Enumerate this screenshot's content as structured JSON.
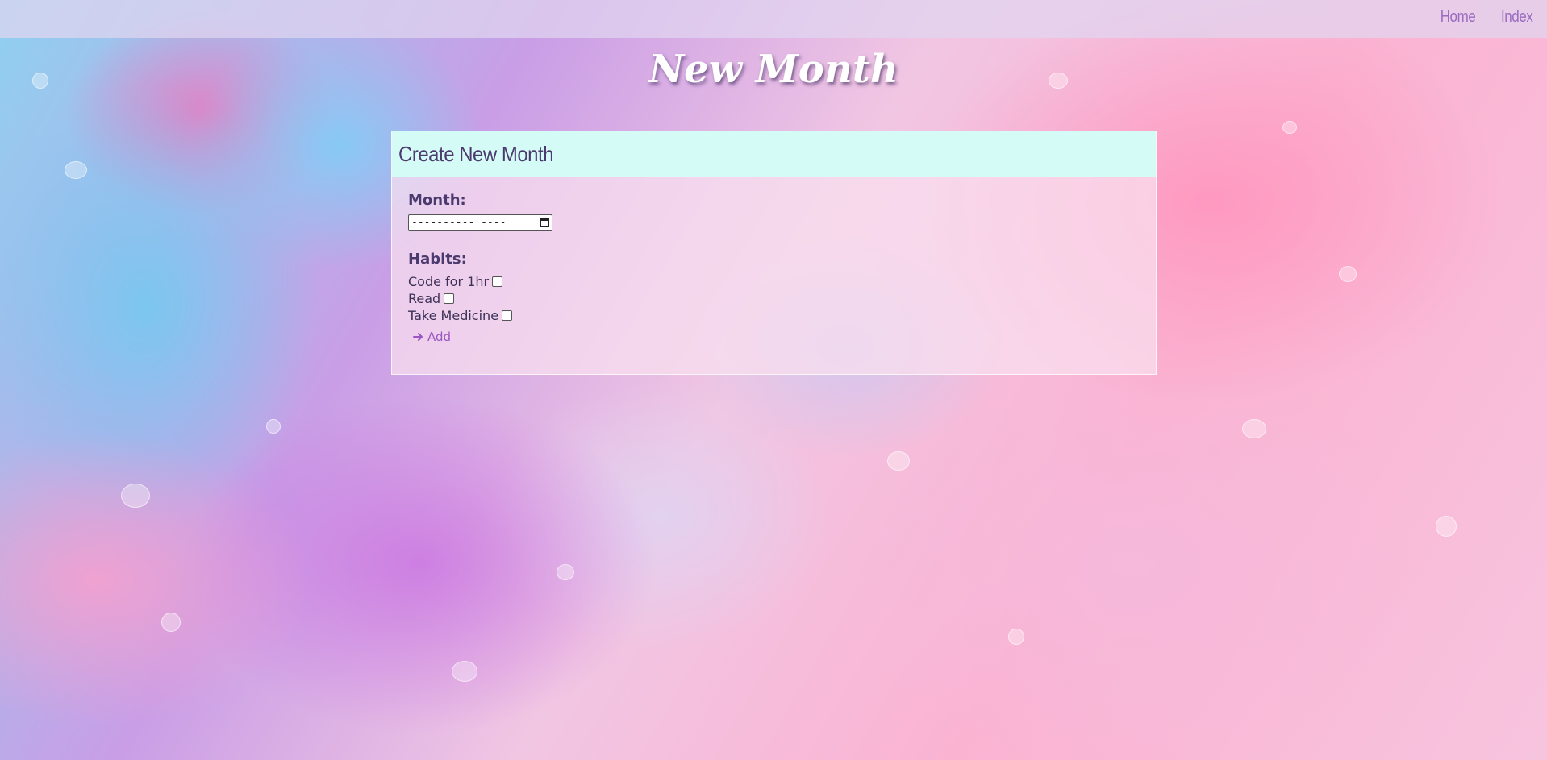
{
  "nav": {
    "items": [
      {
        "label": "Home"
      },
      {
        "label": "Index"
      }
    ]
  },
  "page": {
    "title": "New Month"
  },
  "form": {
    "header": "Create New Month",
    "month_label": "Month:",
    "month_input_value": "---------- ----",
    "habits_label": "Habits:",
    "habits": [
      {
        "label": "Code for 1hr",
        "checked": false
      },
      {
        "label": "Read",
        "checked": false
      },
      {
        "label": "Take Medicine",
        "checked": false
      }
    ],
    "add_label": "Add"
  },
  "icons": {
    "add": "arrow-right-icon",
    "month_picker": "calendar-icon"
  },
  "colors": {
    "header_bg": "#d5fbf6",
    "nav_link": "#9a6cc0",
    "text": "#4b3a6e",
    "add_button": "#9a57c3"
  }
}
